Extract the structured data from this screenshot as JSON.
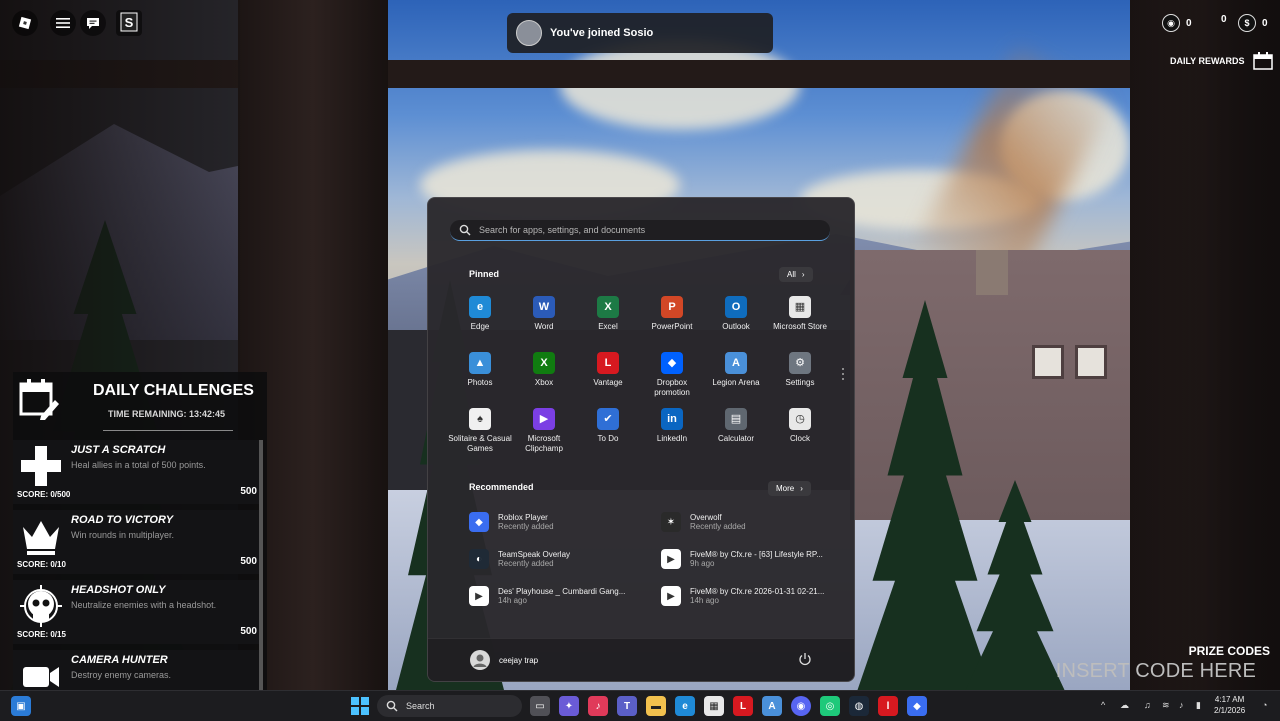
{
  "toast": {
    "text": "You've joined Sosio"
  },
  "hud": {
    "stat1": "0",
    "stat2": "0",
    "stat3": "0",
    "daily_rewards_label": "DAILY REWARDS",
    "dollar_symbol": "$"
  },
  "daily_challenges": {
    "title": "DAILY CHALLENGES",
    "time_remaining": "TIME REMAINING: 13:42:45",
    "items": [
      {
        "name": "JUST A SCRATCH",
        "desc": "Heal allies in a total of 500 points.",
        "score": "SCORE: 0/500",
        "points": "500",
        "icon": "plus-icon"
      },
      {
        "name": "ROAD TO VICTORY",
        "desc": "Win rounds in multiplayer.",
        "score": "SCORE: 0/10",
        "points": "500",
        "icon": "crown-icon"
      },
      {
        "name": "HEADSHOT ONLY",
        "desc": "Neutralize enemies with a headshot.",
        "score": "SCORE: 0/15",
        "points": "500",
        "icon": "skull-icon"
      },
      {
        "name": "CAMERA HUNTER",
        "desc": "Destroy enemy cameras.",
        "score": "",
        "points": "",
        "icon": "camera-icon"
      }
    ]
  },
  "prize": {
    "title": "PRIZE CODES",
    "placeholder": "INSERT CODE HERE"
  },
  "start_menu": {
    "search_placeholder": "Search for apps, settings, and documents",
    "pinned_label": "Pinned",
    "all_label": "All",
    "pinned": [
      {
        "label": "Edge",
        "color": "#1f8ad6",
        "glyph": "e"
      },
      {
        "label": "Word",
        "color": "#2b5bb8",
        "glyph": "W"
      },
      {
        "label": "Excel",
        "color": "#1d7a45",
        "glyph": "X"
      },
      {
        "label": "PowerPoint",
        "color": "#d24726",
        "glyph": "P"
      },
      {
        "label": "Outlook",
        "color": "#0f6cbd",
        "glyph": "O"
      },
      {
        "label": "Microsoft Store",
        "color": "#e8e8e8",
        "glyph": "▦"
      },
      {
        "label": "Photos",
        "color": "#3a8fd9",
        "glyph": "▲"
      },
      {
        "label": "Xbox",
        "color": "#107c10",
        "glyph": "X"
      },
      {
        "label": "Vantage",
        "color": "#d71920",
        "glyph": "L"
      },
      {
        "label": "Dropbox promotion",
        "color": "#0061fe",
        "glyph": "◆"
      },
      {
        "label": "Legion Arena",
        "color": "#4a90d9",
        "glyph": "A"
      },
      {
        "label": "Settings",
        "color": "#6e7680",
        "glyph": "⚙"
      },
      {
        "label": "Solitaire & Casual Games",
        "color": "#f0f0f0",
        "glyph": "♠"
      },
      {
        "label": "Microsoft Clipchamp",
        "color": "#7b3fe4",
        "glyph": "▶"
      },
      {
        "label": "To Do",
        "color": "#2f6fd6",
        "glyph": "✔"
      },
      {
        "label": "LinkedIn",
        "color": "#0a66c2",
        "glyph": "in"
      },
      {
        "label": "Calculator",
        "color": "#5f6770",
        "glyph": "▤"
      },
      {
        "label": "Clock",
        "color": "#e8e8e8",
        "glyph": "◷"
      }
    ],
    "recommended_label": "Recommended",
    "more_label": "More",
    "recommended": [
      {
        "name": "Roblox Player",
        "sub": "Recently added",
        "color": "#3a6df0",
        "glyph": "◆"
      },
      {
        "name": "Overwolf",
        "sub": "Recently added",
        "color": "#2a2a2a",
        "glyph": "✶"
      },
      {
        "name": "TeamSpeak Overlay",
        "sub": "Recently added",
        "color": "#1f2a36",
        "glyph": "◐"
      },
      {
        "name": "FiveM® by Cfx.re - [63] Lifestyle RP...",
        "sub": "9h ago",
        "color": "#ffffff",
        "glyph": "▶"
      },
      {
        "name": "Des' Playhouse _ Cumbardi Gang...",
        "sub": "14h ago",
        "color": "#ffffff",
        "glyph": "▶"
      },
      {
        "name": "FiveM® by Cfx.re 2026-01-31 02-21...",
        "sub": "14h ago",
        "color": "#ffffff",
        "glyph": "▶"
      }
    ],
    "user_name": "ceejay trap"
  },
  "taskbar": {
    "search_label": "Search",
    "time": "4:17 AM",
    "date": "2/1/2026"
  }
}
